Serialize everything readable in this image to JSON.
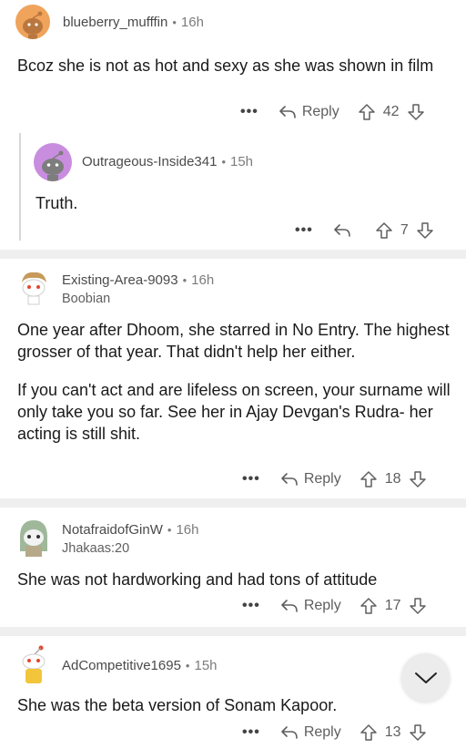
{
  "comments": [
    {
      "author": "blueberry_mufffin",
      "time": "16h",
      "flair": "",
      "body": [
        "Bcoz she is not as hot and sexy as she was shown in film"
      ],
      "reply_label": "Reply",
      "votes": "42",
      "avatar": "orange-snoo-avatar"
    },
    {
      "author": "Outrageous-Inside341",
      "time": "15h",
      "flair": "",
      "body": [
        "Truth."
      ],
      "reply_label": "",
      "votes": "7",
      "avatar": "purple-snoo-avatar"
    },
    {
      "author": "Existing-Area-9093",
      "time": "16h",
      "flair": "Boobian",
      "body": [
        "One year after Dhoom, she starred in No Entry. The highest grosser of that year. That didn't help her either.",
        "If you can't act and are lifeless on screen, your surname will only take you so far. See her in Ajay Devgan's Rudra- her acting is still shit."
      ],
      "reply_label": "Reply",
      "votes": "18",
      "avatar": "curly-hair-snoo-avatar"
    },
    {
      "author": "NotafraidofGinW",
      "time": "16h",
      "flair": "Jhakaas:20",
      "body": [
        "She was not hardworking and had tons of attitude"
      ],
      "reply_label": "Reply",
      "votes": "17",
      "avatar": "hooded-snoo-avatar"
    },
    {
      "author": "AdCompetitive1695",
      "time": "15h",
      "flair": "",
      "body": [
        "She was the beta version of Sonam Kapoor."
      ],
      "reply_label": "Reply",
      "votes": "13",
      "avatar": "yellow-shirt-snoo-avatar"
    }
  ],
  "more_label": "•••",
  "separator_dot": "•",
  "colors": {
    "orange": "#f0a35b",
    "purple": "#c98de0",
    "separator": "#efefef",
    "text": "#1a1a1b"
  }
}
